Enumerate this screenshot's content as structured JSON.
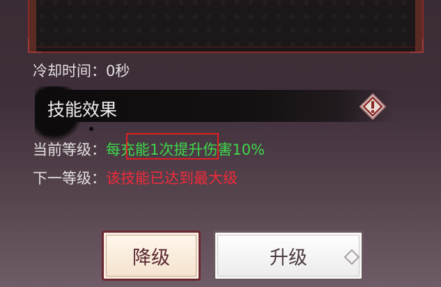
{
  "skill": {
    "cooldown_text": "冷却时间：0秒",
    "section_title": "技能效果",
    "current_level_label": "当前等级：",
    "current_level_effect": "每充能1次提升伤害10%",
    "next_level_label": "下一等级：",
    "next_level_effect": "该技能已达到最大级"
  },
  "buttons": {
    "downgrade_label": "降级",
    "upgrade_label": "升级"
  },
  "colors": {
    "effect_green": "#3dd84a",
    "max_level_red": "#ef2b3b",
    "highlight_box": "#e02020"
  }
}
